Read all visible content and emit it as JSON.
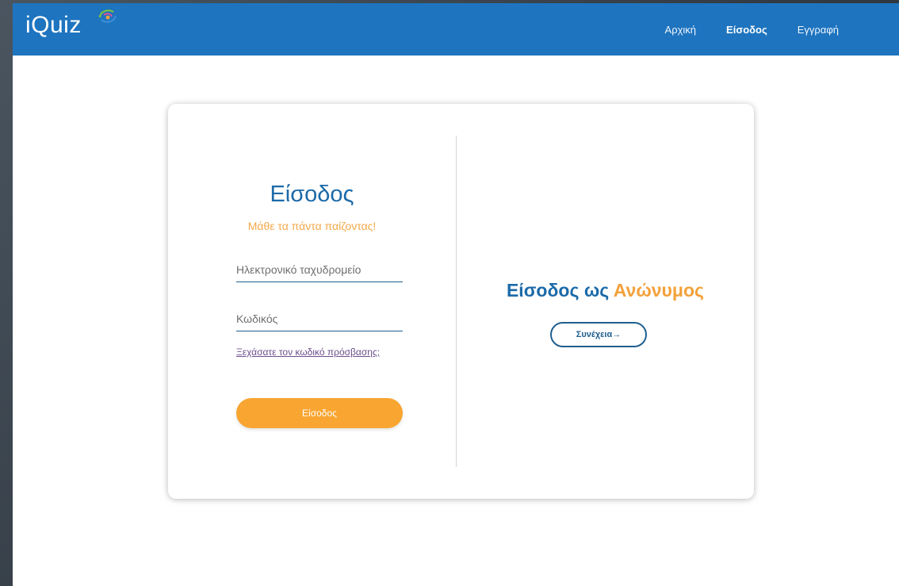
{
  "brand": {
    "name": "iQuiz",
    "accent_colors": [
      "#7fc241",
      "#e8509a",
      "#3a8fd8",
      "#f3a13a"
    ]
  },
  "nav": {
    "items": [
      {
        "label": "Αρχική",
        "active": false
      },
      {
        "label": "Είσοδος",
        "active": true
      },
      {
        "label": "Εγγραφή",
        "active": false
      }
    ]
  },
  "login": {
    "title": "Είσοδος",
    "subtitle": "Μάθε τα πάντα παίζοντας!",
    "email_placeholder": "Ηλεκτρονικό ταχυδρομείο",
    "password_placeholder": "Κωδικός",
    "forgot_link": "Ξεχάσατε τον κωδικό πρόσβασης;",
    "submit_label": "Είσοδος"
  },
  "anonymous": {
    "title_part1": "Είσοδος ως ",
    "title_part2": "Ανώνυμος",
    "continue_label": "Συνέχεια→"
  },
  "colors": {
    "navbar": "#1e74bf",
    "primary_blue": "#1c6aa8",
    "orange": "#f8a531"
  }
}
